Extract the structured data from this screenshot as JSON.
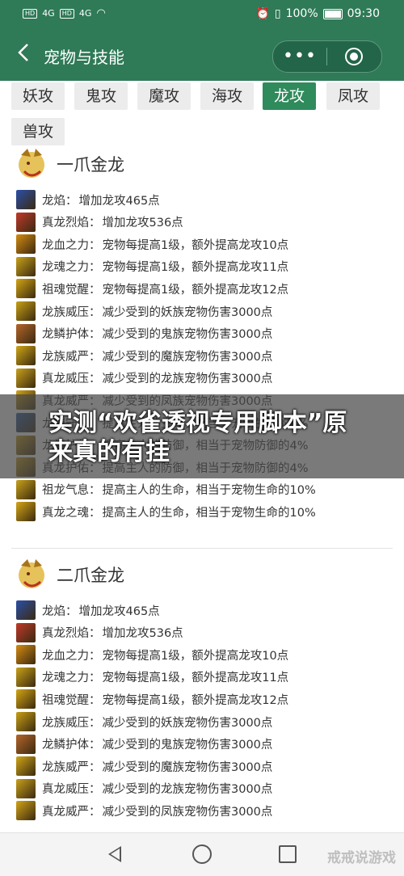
{
  "status": {
    "sim1": "HD",
    "sim2": "HD",
    "net1": "4G",
    "net2": "4G",
    "battery": "100%",
    "time": "09:30"
  },
  "header": {
    "back_icon": "chevron-left-icon",
    "title": "宠物与技能",
    "more_icon": "more-dots-icon",
    "close_icon": "target-icon",
    "color": "#2f7a57"
  },
  "tabs": [
    "妖攻",
    "鬼攻",
    "魔攻",
    "海攻",
    "龙攻",
    "凤攻",
    "兽攻"
  ],
  "active_tab": "龙攻",
  "sections": [
    {
      "title": "一爪金龙",
      "skills": [
        {
          "name": "龙焰：",
          "desc": "增加龙攻465点"
        },
        {
          "name": "真龙烈焰：",
          "desc": "增加龙攻536点"
        },
        {
          "name": "龙血之力：",
          "desc": "宠物每提高1级，额外提高龙攻10点"
        },
        {
          "name": "龙魂之力：",
          "desc": "宠物每提高1级，额外提高龙攻11点"
        },
        {
          "name": "祖魂觉醒：",
          "desc": "宠物每提高1级，额外提高龙攻12点"
        },
        {
          "name": "龙族威压：",
          "desc": "减少受到的妖族宠物伤害3000点"
        },
        {
          "name": "龙鳞护体：",
          "desc": "减少受到的鬼族宠物伤害3000点"
        },
        {
          "name": "龙族威严：",
          "desc": "减少受到的魔族宠物伤害3000点"
        },
        {
          "name": "真龙威压：",
          "desc": "减少受到的龙族宠物伤害3000点"
        },
        {
          "name": "真龙威严：",
          "desc": "减少受到的凤族宠物伤害3000点"
        },
        {
          "name": "龙族守护：",
          "desc": "提高主人的生命，相当于宠物生命的8%"
        },
        {
          "name": "龙族护佑：",
          "desc": "提高主人的防御，相当于宠物防御的4%"
        },
        {
          "name": "真龙护佑：",
          "desc": "提高主人的防御，相当于宠物防御的4%"
        },
        {
          "name": "祖龙气息：",
          "desc": "提高主人的生命，相当于宠物生命的10%"
        },
        {
          "name": "真龙之魂：",
          "desc": "提高主人的生命，相当于宠物生命的10%"
        }
      ]
    },
    {
      "title": "二爪金龙",
      "skills": [
        {
          "name": "龙焰：",
          "desc": "增加龙攻465点"
        },
        {
          "name": "真龙烈焰：",
          "desc": "增加龙攻536点"
        },
        {
          "name": "龙血之力：",
          "desc": "宠物每提高1级，额外提高龙攻10点"
        },
        {
          "name": "龙魂之力：",
          "desc": "宠物每提高1级，额外提高龙攻11点"
        },
        {
          "name": "祖魂觉醒：",
          "desc": "宠物每提高1级，额外提高龙攻12点"
        },
        {
          "name": "龙族威压：",
          "desc": "减少受到的妖族宠物伤害3000点"
        },
        {
          "name": "龙鳞护体：",
          "desc": "减少受到的鬼族宠物伤害3000点"
        },
        {
          "name": "龙族威严：",
          "desc": "减少受到的魔族宠物伤害3000点"
        },
        {
          "name": "真龙威压：",
          "desc": "减少受到的龙族宠物伤害3000点"
        },
        {
          "name": "真龙威严：",
          "desc": "减少受到的凤族宠物伤害3000点"
        }
      ]
    }
  ],
  "overlay": {
    "headline": "实测“欢雀透视专用脚本”原来真的有挂"
  },
  "watermark": "戒戒说游戏",
  "nav": {
    "back_icon": "nav-back-icon",
    "home_icon": "nav-home-icon",
    "recent_icon": "nav-recent-icon"
  }
}
